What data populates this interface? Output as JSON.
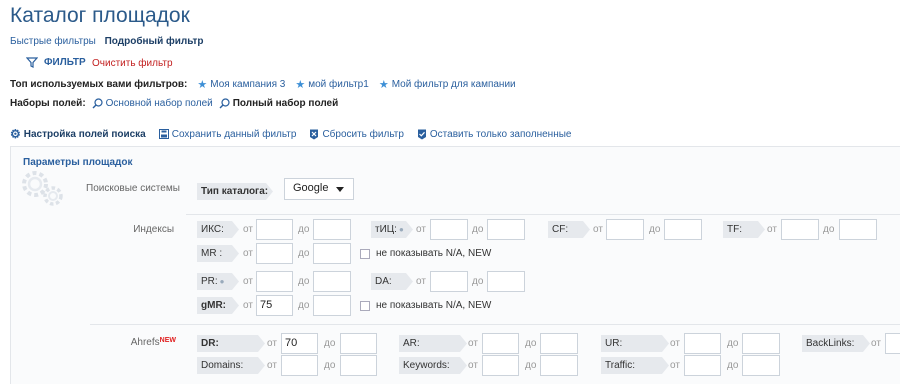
{
  "page": {
    "title": "Каталог площадок"
  },
  "modes": {
    "quick": "Быстрые фильтры",
    "detailed": "Подробный фильтр"
  },
  "filter": {
    "button_label": "ФИЛЬТР",
    "clear_label": "Очистить фильтр"
  },
  "top_filters": {
    "label": "Топ используемых вами фильтров:",
    "items": [
      "Моя кампания 3",
      "мой фильтр1",
      "Мой фильтр для кампании"
    ]
  },
  "field_sets": {
    "label": "Наборы полей:",
    "basic": "Основной набор полей",
    "full": "Полный набор полей"
  },
  "actions": {
    "settings": "Настройка полей поиска",
    "save": "Сохранить данный фильтр",
    "reset": "Сбросить фильтр",
    "keep_filled": "Оставить только заполненные"
  },
  "panel": {
    "title": "Параметры площадок",
    "search_systems": {
      "label": "Поисковые системы",
      "catalog_type_label": "Тип каталога:",
      "catalog_type_value": "Google"
    },
    "indexes": {
      "label": "Индексы",
      "from": "от",
      "to": "до",
      "fields": {
        "iks": "ИКС:",
        "tic": "тИЦ:",
        "cf": "CF:",
        "tf": "TF:",
        "mr": "MR :",
        "pr": "PR:",
        "da": "DA:",
        "gmr": "gMR:"
      },
      "gmr_from": "75",
      "hide_na": "не показывать N/A, NEW"
    },
    "ahrefs": {
      "label": "Ahrefs",
      "new_badge": "NEW",
      "fields": {
        "dr": "DR:",
        "ar": "AR:",
        "ur": "UR:",
        "backlinks": "BackLinks:",
        "domains": "Domains:",
        "keywords": "Keywords:",
        "traffic": "Traffic:"
      },
      "dr_from": "70"
    }
  },
  "colors": {
    "link": "#2a5f9e",
    "title": "#2b5a8a",
    "clear": "#c21f1f",
    "tag_bg": "#e6e9ed"
  }
}
